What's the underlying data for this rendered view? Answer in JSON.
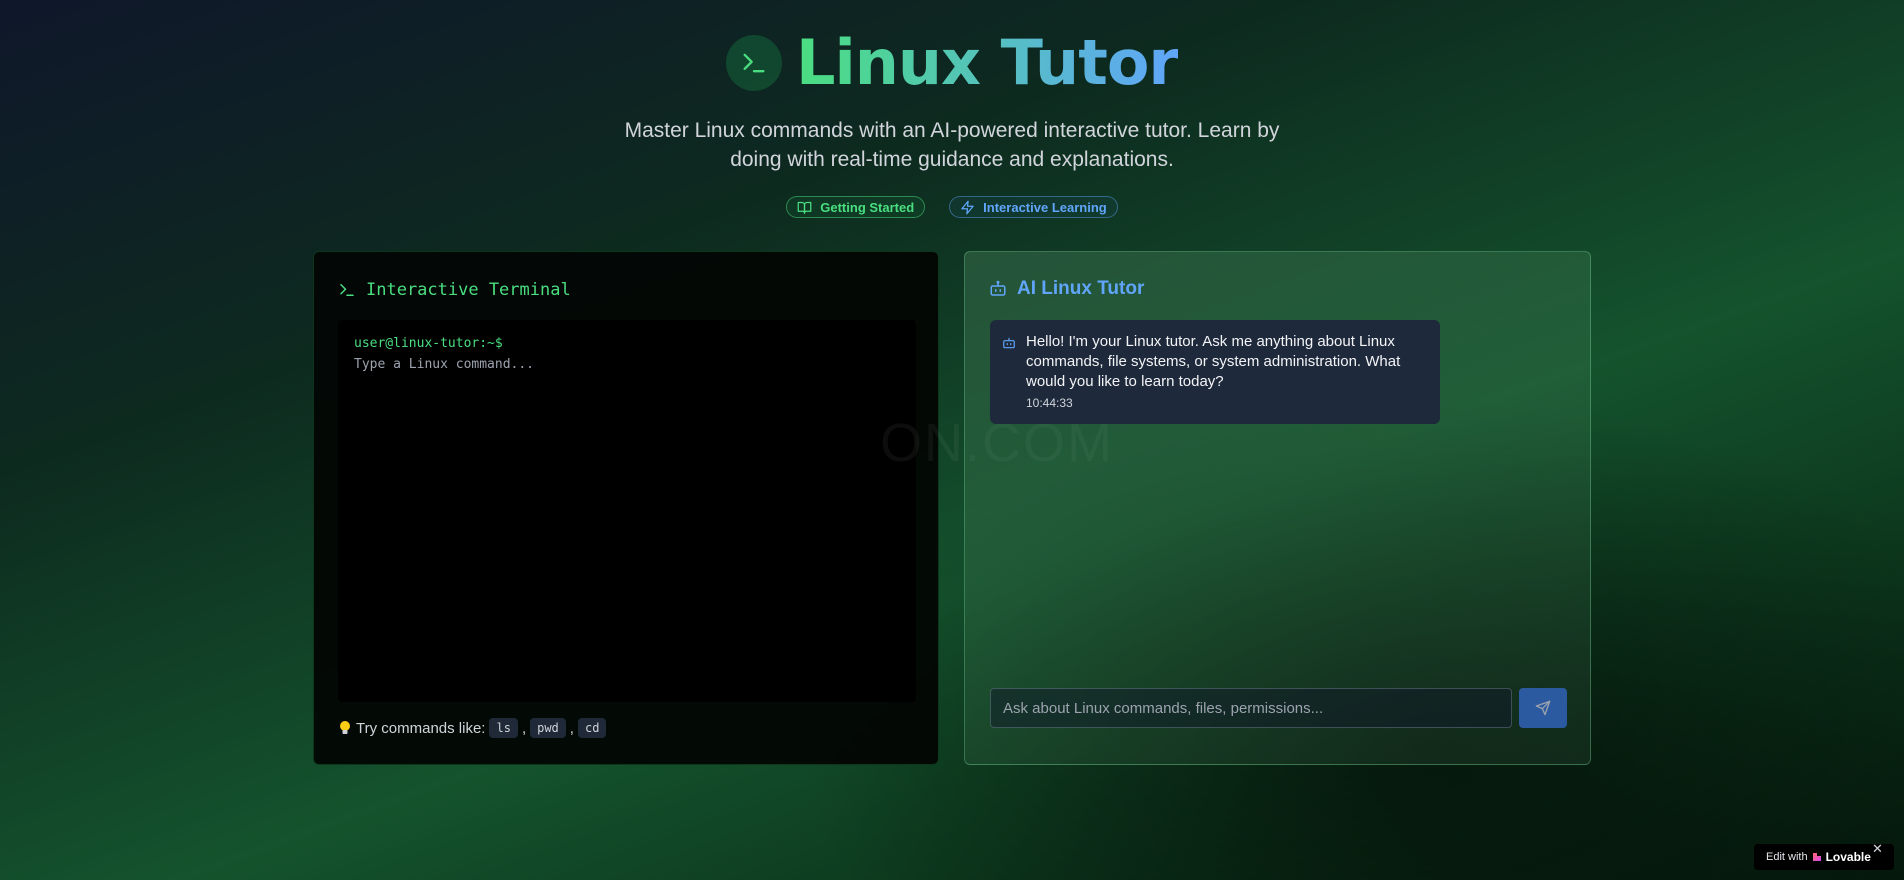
{
  "header": {
    "title": "Linux Tutor",
    "subtitle": "Master Linux commands with an AI-powered interactive tutor. Learn by doing with real-time guidance and explanations.",
    "badges": [
      {
        "label": "Getting Started",
        "icon": "book-open-icon"
      },
      {
        "label": "Interactive Learning",
        "icon": "lightning-icon"
      }
    ]
  },
  "terminal": {
    "title": "Interactive Terminal",
    "prompt": "user@linux-tutor:~$",
    "input_placeholder": "Type a Linux command...",
    "hint_label": "Try commands like:",
    "hint_commands": [
      "ls",
      "pwd",
      "cd"
    ],
    "hint_separator": ","
  },
  "tutor": {
    "title": "AI Linux Tutor",
    "messages": [
      {
        "text": "Hello! I'm your Linux tutor. Ask me anything about Linux commands, file systems, or system administration. What would you like to learn today?",
        "time": "10:44:33"
      }
    ],
    "input_placeholder": "Ask about Linux commands, files, permissions..."
  },
  "watermark": "ON.COM",
  "footer": {
    "edit_with": "Edit with",
    "brand": "Lovable",
    "close": "✕"
  },
  "colors": {
    "accent_green": "#4ade80",
    "accent_blue": "#60a5fa",
    "send_button": "#2c5aa0"
  }
}
